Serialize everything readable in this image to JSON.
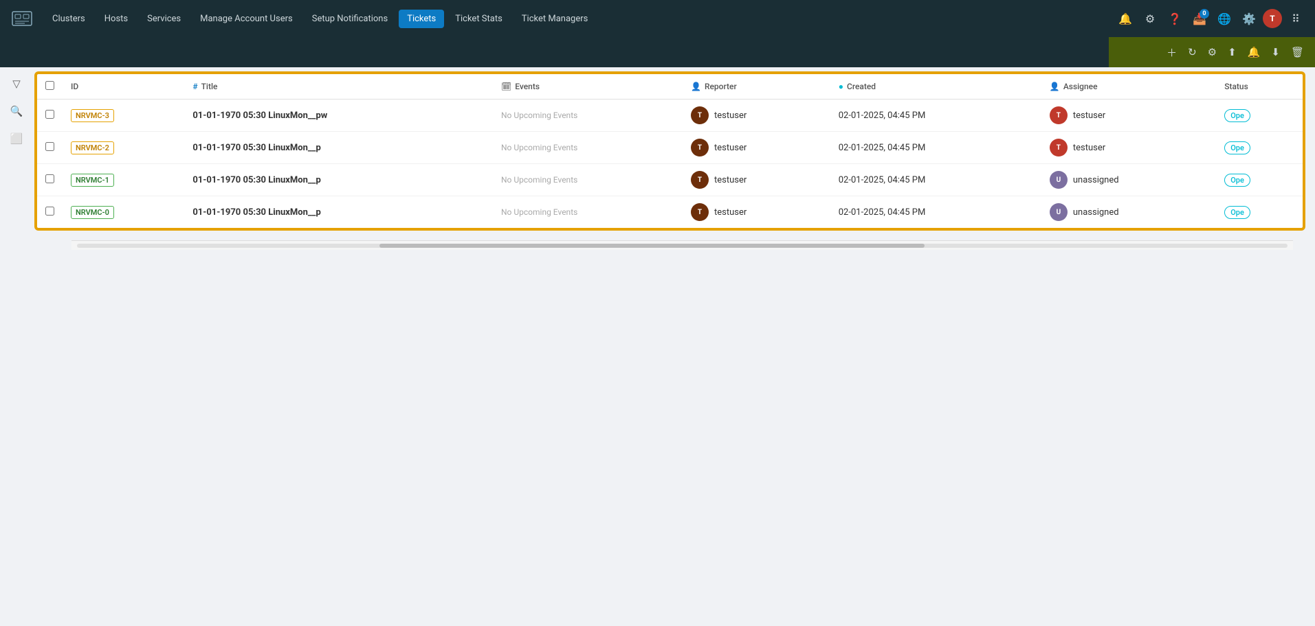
{
  "nav": {
    "items": [
      {
        "label": "Clusters",
        "active": false
      },
      {
        "label": "Hosts",
        "active": false
      },
      {
        "label": "Services",
        "active": false
      },
      {
        "label": "Manage Account Users",
        "active": false
      },
      {
        "label": "Setup Notifications",
        "active": false
      },
      {
        "label": "Tickets",
        "active": true
      },
      {
        "label": "Ticket Stats",
        "active": false
      },
      {
        "label": "Ticket Managers",
        "active": false
      }
    ],
    "badge_count": "0"
  },
  "subheader": {
    "actions": [
      "+",
      "↻",
      "⚙",
      "↑",
      "🔔",
      "↓",
      "🗑"
    ]
  },
  "table": {
    "columns": [
      "",
      "ID",
      "# Title",
      "Events",
      "Reporter",
      "Created",
      "Assignee",
      "Status"
    ],
    "rows": [
      {
        "id": "NRVMC-3",
        "id_color": "orange",
        "title": "01-01-1970 05:30 LinuxMon__pw",
        "events": "No Upcoming Events",
        "reporter": "testuser",
        "reporter_color": "brown",
        "created": "02-01-2025, 04:45 PM",
        "assignee": "testuser",
        "assignee_color": "red",
        "status": "Ope"
      },
      {
        "id": "NRVMC-2",
        "id_color": "orange",
        "title": "01-01-1970 05:30 LinuxMon__p",
        "events": "No Upcoming Events",
        "reporter": "testuser",
        "reporter_color": "brown",
        "created": "02-01-2025, 04:45 PM",
        "assignee": "testuser",
        "assignee_color": "red",
        "status": "Ope"
      },
      {
        "id": "NRVMC-1",
        "id_color": "green",
        "title": "01-01-1970 05:30 LinuxMon__p",
        "events": "No Upcoming Events",
        "reporter": "testuser",
        "reporter_color": "brown",
        "created": "02-01-2025, 04:45 PM",
        "assignee": "unassigned",
        "assignee_color": "purple",
        "status": "Ope"
      },
      {
        "id": "NRVMC-0",
        "id_color": "green",
        "title": "01-01-1970 05:30 LinuxMon__p",
        "events": "No Upcoming Events",
        "reporter": "testuser",
        "reporter_color": "brown",
        "created": "02-01-2025, 04:45 PM",
        "assignee": "unassigned",
        "assignee_color": "purple",
        "status": "Ope"
      }
    ]
  }
}
